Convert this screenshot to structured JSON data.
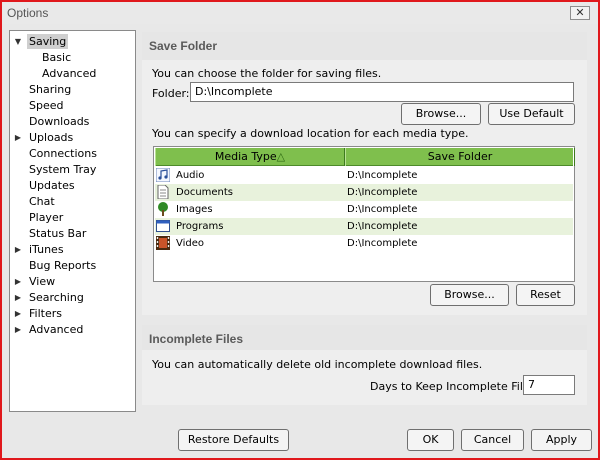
{
  "window": {
    "title": "Options",
    "close_label": "✕"
  },
  "sidebar": {
    "items": [
      {
        "label": "Saving",
        "arrow": "▼",
        "selected": true
      },
      {
        "label": "Basic"
      },
      {
        "label": "Advanced"
      },
      {
        "label": "Sharing"
      },
      {
        "label": "Speed"
      },
      {
        "label": "Downloads"
      },
      {
        "label": "Uploads",
        "arrow": "▶"
      },
      {
        "label": "Connections"
      },
      {
        "label": "System Tray"
      },
      {
        "label": "Updates"
      },
      {
        "label": "Chat"
      },
      {
        "label": "Player"
      },
      {
        "label": "Status Bar"
      },
      {
        "label": "iTunes",
        "arrow": "▶"
      },
      {
        "label": "Bug Reports"
      },
      {
        "label": "View",
        "arrow": "▶"
      },
      {
        "label": "Searching",
        "arrow": "▶"
      },
      {
        "label": "Filters",
        "arrow": "▶"
      },
      {
        "label": "Advanced",
        "arrow": "▶"
      }
    ]
  },
  "save_folder": {
    "title": "Save Folder",
    "description": "You can choose the folder for saving files.",
    "folder_label": "Folder:",
    "folder_value": "D:\\Incomplete",
    "browse_label": "Browse...",
    "use_default_label": "Use Default",
    "media_description": "You can specify a download location for each media type.",
    "table": {
      "columns": [
        "Media Type",
        "Save Folder"
      ],
      "sort_indicator": "△",
      "rows": [
        {
          "type": "Audio",
          "folder": "D:\\Incomplete",
          "icon": "audio-note-icon"
        },
        {
          "type": "Documents",
          "folder": "D:\\Incomplete",
          "icon": "document-icon"
        },
        {
          "type": "Images",
          "folder": "D:\\Incomplete",
          "icon": "tree-image-icon"
        },
        {
          "type": "Programs",
          "folder": "D:\\Incomplete",
          "icon": "program-window-icon"
        },
        {
          "type": "Video",
          "folder": "D:\\Incomplete",
          "icon": "film-video-icon"
        }
      ]
    },
    "table_browse_label": "Browse...",
    "reset_label": "Reset"
  },
  "incomplete_files": {
    "title": "Incomplete Files",
    "description": "You can automatically delete old incomplete download files.",
    "days_label": "Days to Keep Incomplete Files:",
    "days_value": "7"
  },
  "footer": {
    "restore_label": "Restore Defaults",
    "ok_label": "OK",
    "cancel_label": "Cancel",
    "apply_label": "Apply"
  },
  "colors": {
    "header_green": "#7fbf4d",
    "row_alt": "#e8f2dc",
    "window_border": "#e0181c"
  }
}
